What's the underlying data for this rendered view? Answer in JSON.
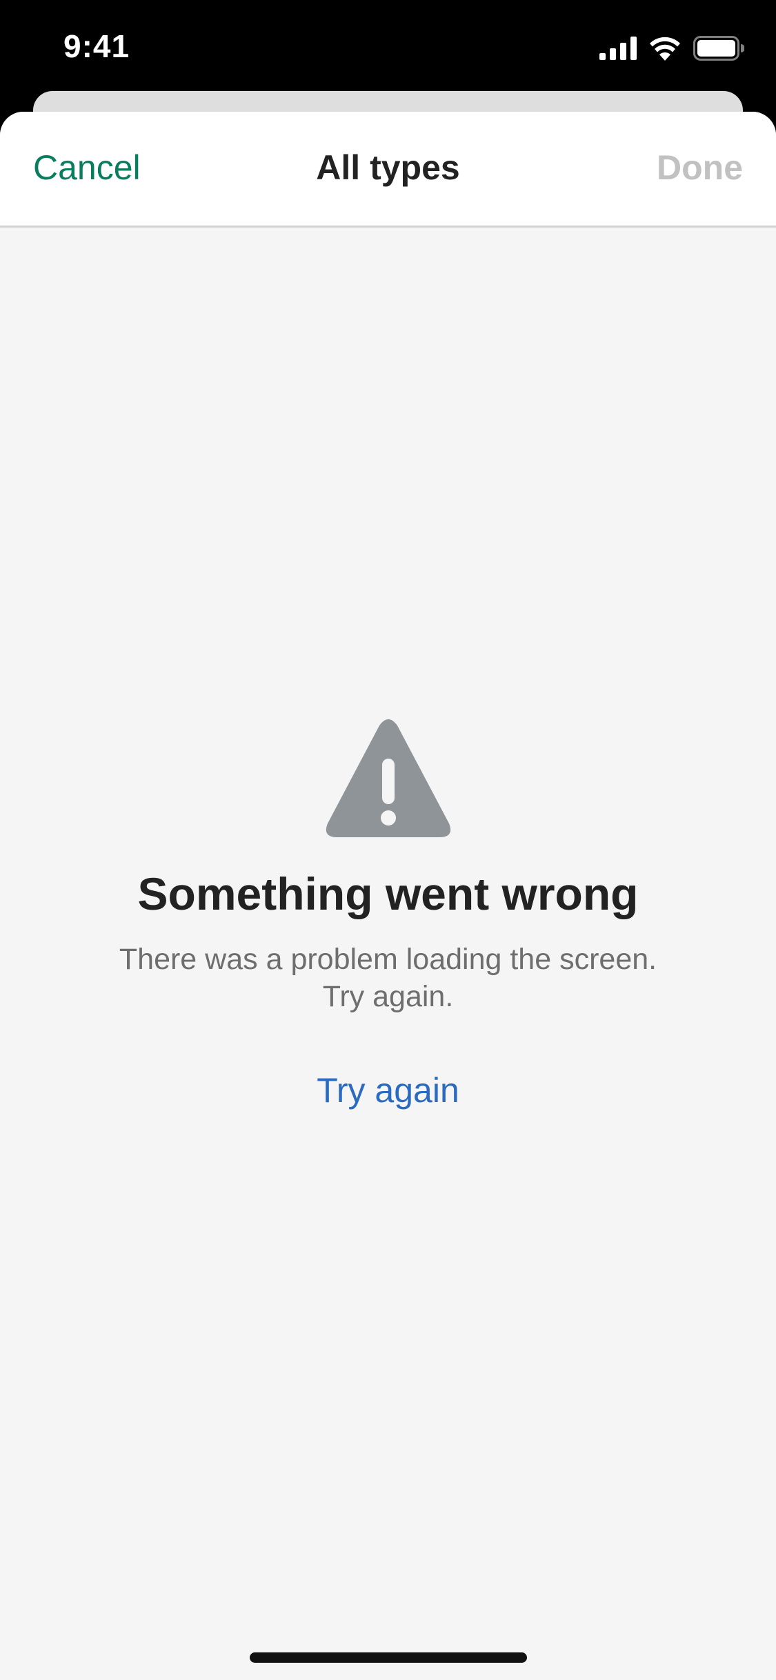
{
  "status_bar": {
    "time": "9:41",
    "icons": [
      "cellular-signal-icon",
      "wifi-icon",
      "battery-icon"
    ]
  },
  "nav": {
    "cancel_label": "Cancel",
    "title": "All types",
    "done_label": "Done"
  },
  "error": {
    "icon": "warning-triangle-icon",
    "title": "Something went wrong",
    "message_line1": "There was a problem loading the screen.",
    "message_line2": "Try again.",
    "retry_label": "Try again"
  },
  "colors": {
    "accent_green": "#0a7d5f",
    "link_blue": "#2b6bbf",
    "disabled_gray": "#c1c1c1",
    "icon_gray": "#8f9498",
    "background": "#f5f5f5"
  }
}
